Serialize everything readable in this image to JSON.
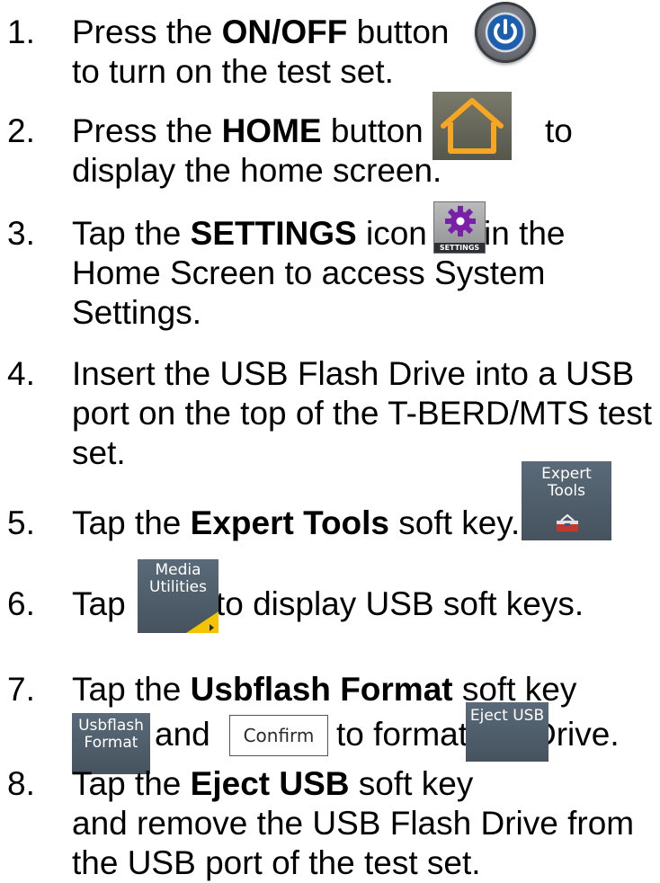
{
  "steps": [
    {
      "number": "1.",
      "line1_pre": "Press the ",
      "line1_bold": "ON/OFF",
      "line1_post": " button",
      "line2": "to turn on the test set.",
      "icon": "power-icon"
    },
    {
      "number": "2.",
      "line1_pre": "Press the ",
      "line1_bold": "HOME",
      "line1_post": " button",
      "line1_tail": "to",
      "line2": "display the home screen.",
      "icon": "home-icon"
    },
    {
      "number": "3.",
      "line1_pre": "Tap the ",
      "line1_bold": "SETTINGS",
      "line1_post": " icon",
      "line1_tail": " in the",
      "line2": "Home Screen to access System",
      "line3": "Settings.",
      "icon": "gear-icon",
      "icon_label": "SETTINGS"
    },
    {
      "number": "4.",
      "line1": "Insert the USB Flash Drive into a USB",
      "line2": "port on the top of the T-BERD/MTS test",
      "line3": "set."
    },
    {
      "number": "5.",
      "line1_pre": "Tap the ",
      "line1_bold": "Expert Tools",
      "line1_post": " soft key.",
      "softkey_line1": "Expert",
      "softkey_line2": "Tools",
      "icon": "toolbox-icon"
    },
    {
      "number": "6.",
      "line1_pre": "Tap",
      "line1_post": " to display USB soft keys.",
      "softkey_line1": "Media",
      "softkey_line2": "Utilities"
    },
    {
      "number": "7.",
      "line1_pre": "Tap the ",
      "line1_bold": "Usbflash Format",
      "line1_post": " soft key",
      "line2_mid": "and",
      "line2_post": "to format the Drive.",
      "softkey_line1": "Usbflash",
      "softkey_line2": "Format",
      "confirm_label": "Confirm"
    },
    {
      "number": "8.",
      "line1_pre": "Tap the ",
      "line1_bold": "Eject USB",
      "line1_post": " soft key",
      "line2": "and remove the USB Flash Drive from",
      "line3": "the USB port of the test set.",
      "softkey_label": "Eject USB"
    }
  ],
  "colors": {
    "text": "#000000",
    "softkey_bg": "#4e5c69",
    "home_icon_orange": "#f5a623",
    "gear_purple": "#7a1fa8",
    "accent_yellow": "#f5c400"
  }
}
